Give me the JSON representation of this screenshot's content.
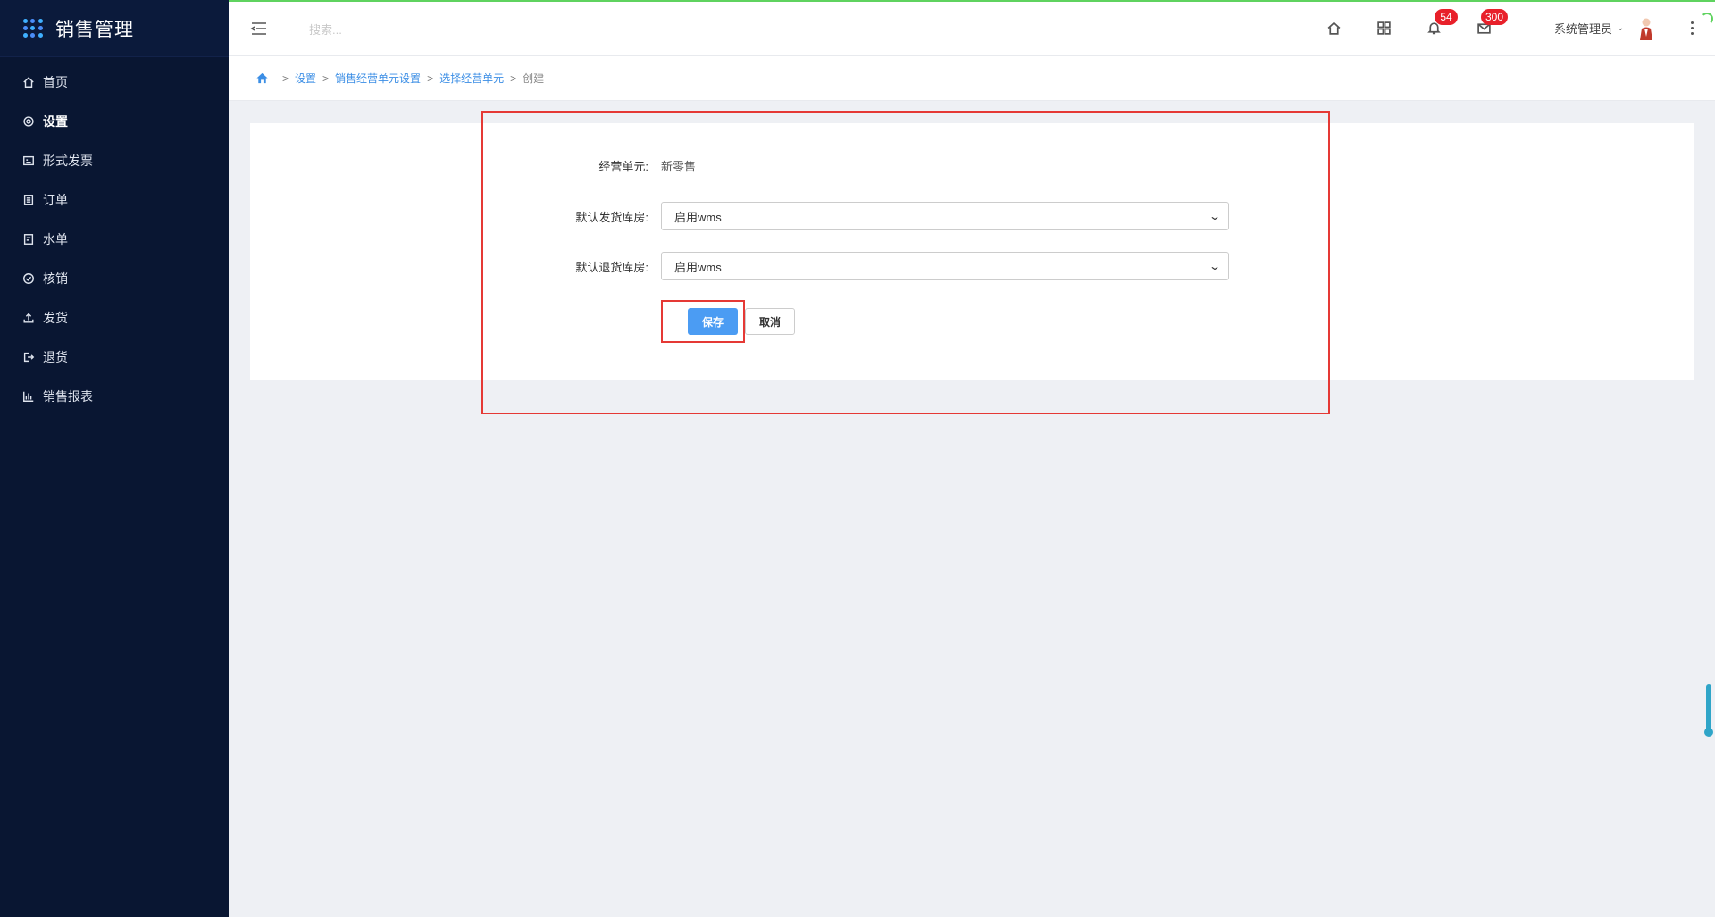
{
  "app": {
    "title": "销售管理"
  },
  "sidebar": {
    "items": [
      {
        "label": "首页",
        "icon": "home-icon",
        "active": false
      },
      {
        "label": "设置",
        "icon": "gear-icon",
        "active": true
      },
      {
        "label": "形式发票",
        "icon": "invoice-icon",
        "active": false
      },
      {
        "label": "订单",
        "icon": "order-icon",
        "active": false
      },
      {
        "label": "水单",
        "icon": "receipt-icon",
        "active": false
      },
      {
        "label": "核销",
        "icon": "check-circle-icon",
        "active": false
      },
      {
        "label": "发货",
        "icon": "upload-icon",
        "active": false
      },
      {
        "label": "退货",
        "icon": "logout-icon",
        "active": false
      },
      {
        "label": "销售报表",
        "icon": "bar-chart-icon",
        "active": false
      }
    ]
  },
  "topbar": {
    "search_placeholder": "搜索...",
    "notifications_count": "54",
    "messages_count": "300",
    "user_name": "系统管理员"
  },
  "breadcrumb": {
    "items": [
      "设置",
      "销售经营单元设置",
      "选择经营单元"
    ],
    "current": "创建"
  },
  "form": {
    "unit_label": "经营单元:",
    "unit_value": "新零售",
    "ship_warehouse_label": "默认发货库房:",
    "ship_warehouse_value": "启用wms",
    "return_warehouse_label": "默认退货库房:",
    "return_warehouse_value": "启用wms",
    "save_label": "保存",
    "cancel_label": "取消"
  },
  "colors": {
    "sidebar_bg": "#091632",
    "accent": "#4b9cf3",
    "highlight": "#e53935",
    "badge": "#e8202a"
  }
}
